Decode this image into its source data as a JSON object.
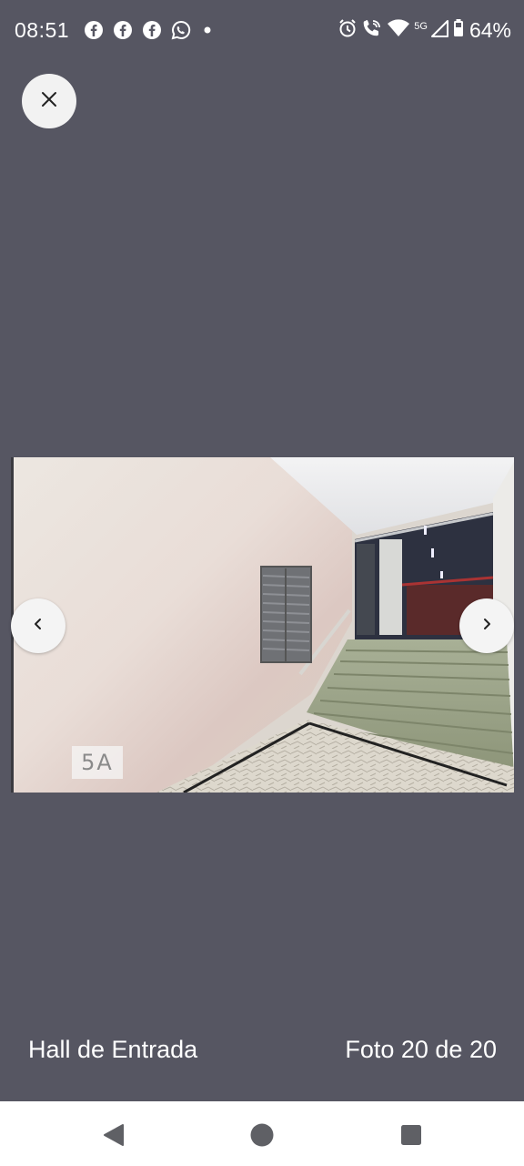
{
  "status_bar": {
    "time": "08:51",
    "battery": "64%",
    "network": "5G",
    "left_icons": [
      "facebook-icon",
      "facebook-icon",
      "facebook-icon",
      "whatsapp-icon",
      "dot-icon"
    ],
    "right_icons": [
      "alarm-icon",
      "wifi-call-icon",
      "wifi-icon",
      "signal-icon",
      "battery-icon"
    ]
  },
  "viewer": {
    "close_icon": "close-icon",
    "prev_icon": "chevron-left-icon",
    "next_icon": "chevron-right-icon",
    "watermark": "5A"
  },
  "caption": {
    "title": "Hall de Entrada",
    "counter": "Foto 20 de 20"
  },
  "system_nav": {
    "back_icon": "back-triangle-icon",
    "home_icon": "home-circle-icon",
    "recent_icon": "recent-square-icon"
  },
  "colors": {
    "background": "#565662",
    "button_bg": "#f2f2f2",
    "text": "#ffffff"
  }
}
